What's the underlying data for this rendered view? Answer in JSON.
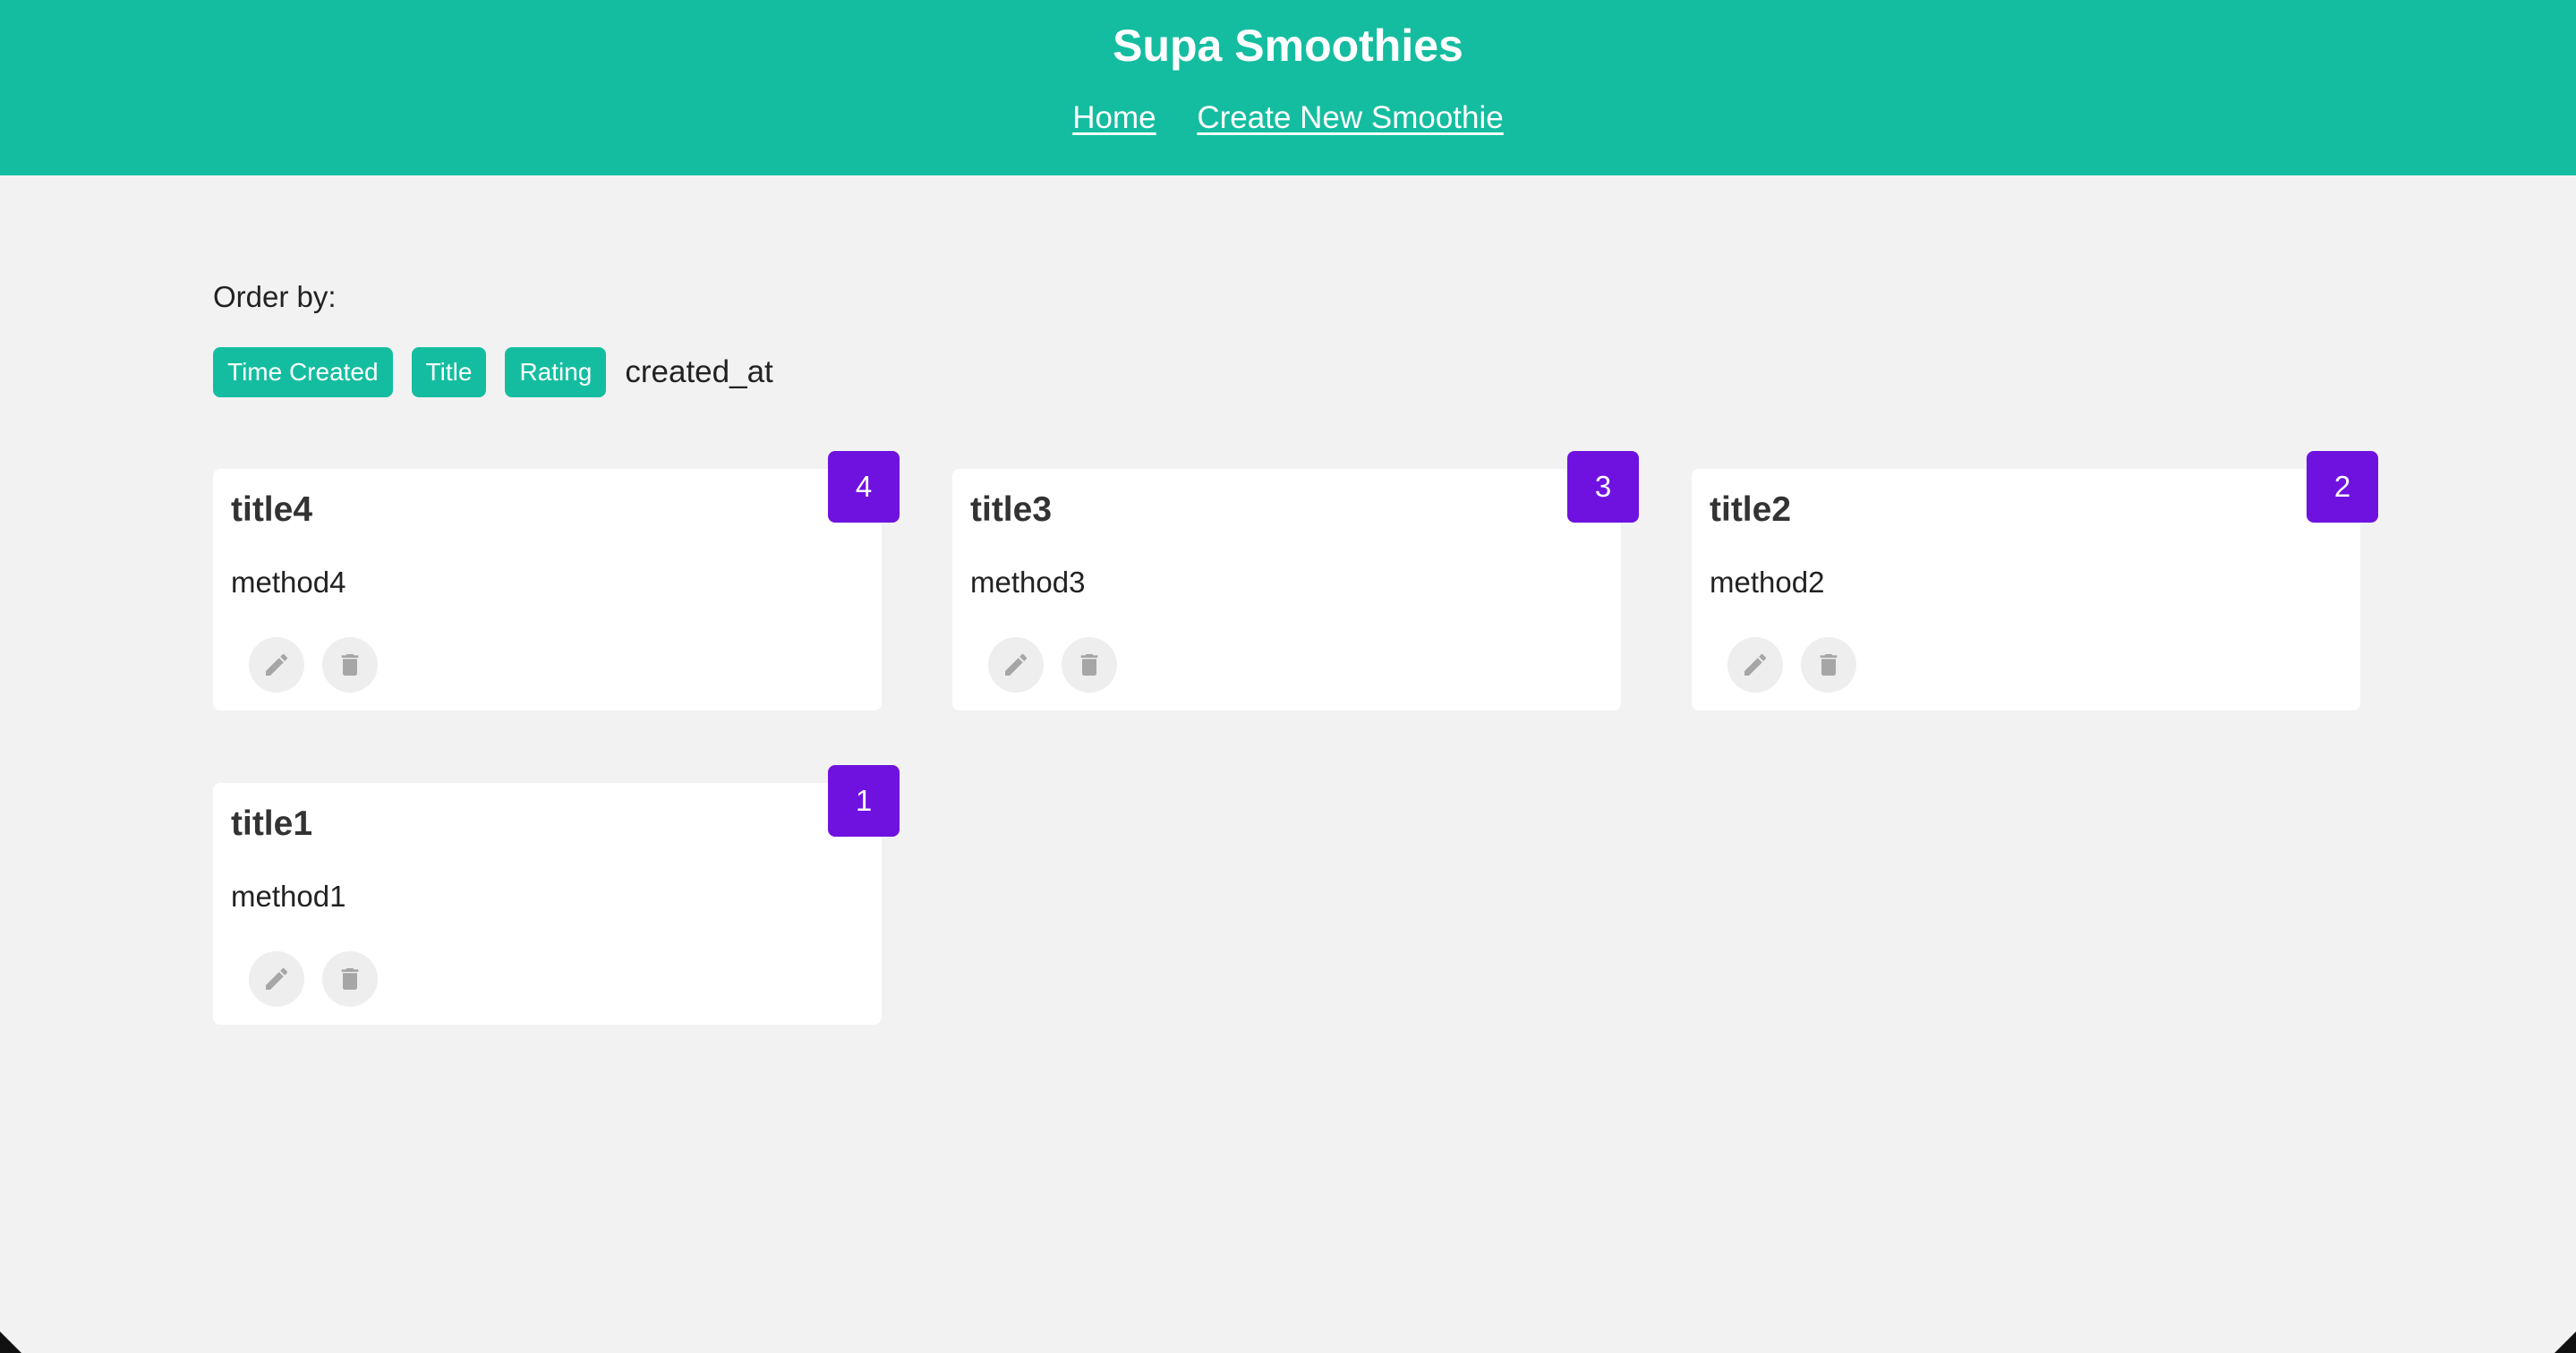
{
  "header": {
    "title": "Supa Smoothies",
    "nav": {
      "home": "Home",
      "create": "Create New Smoothie"
    },
    "background_color": "#15bda0"
  },
  "order": {
    "label": "Order by:",
    "buttons": [
      "Time Created",
      "Title",
      "Rating"
    ],
    "current_value": "created_at"
  },
  "smoothies": [
    {
      "title": "title4",
      "method": "method4",
      "rating": "4"
    },
    {
      "title": "title3",
      "method": "method3",
      "rating": "3"
    },
    {
      "title": "title2",
      "method": "method2",
      "rating": "2"
    },
    {
      "title": "title1",
      "method": "method1",
      "rating": "1"
    }
  ],
  "icons": {
    "edit": "pencil-icon",
    "delete": "trash-icon"
  },
  "colors": {
    "accent": "#15bda0",
    "rating_badge": "#6f12e0",
    "background": "#f2f2f2"
  }
}
